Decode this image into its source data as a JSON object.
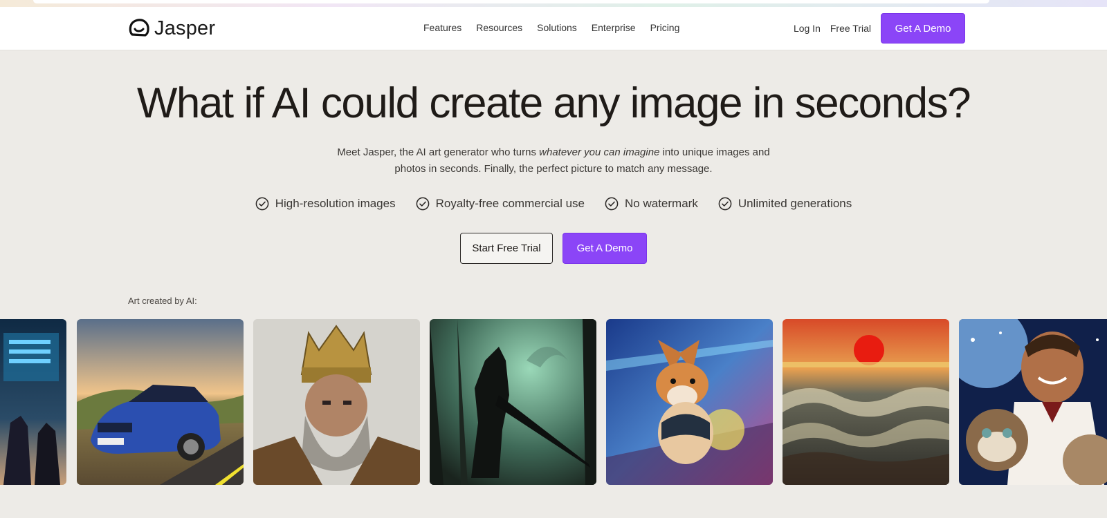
{
  "header": {
    "brand": "Jasper",
    "nav": [
      "Features",
      "Resources",
      "Solutions",
      "Enterprise",
      "Pricing"
    ],
    "login": "Log In",
    "free_trial": "Free Trial",
    "demo": "Get A Demo"
  },
  "hero": {
    "title": "What if AI could create any image in seconds?",
    "subtitle_before": "Meet Jasper, the AI art generator who turns ",
    "subtitle_em": "whatever you can imagine",
    "subtitle_after": " into unique images and photos in seconds. Finally, the perfect picture to match any message.",
    "features": [
      "High-resolution images",
      "Royalty-free commercial use",
      "No watermark",
      "Unlimited generations"
    ],
    "start_trial": "Start Free Trial",
    "demo": "Get A Demo"
  },
  "gallery": {
    "label": "Art created by AI:"
  },
  "colors": {
    "accent": "#8b45f7",
    "background": "#edebe7"
  }
}
